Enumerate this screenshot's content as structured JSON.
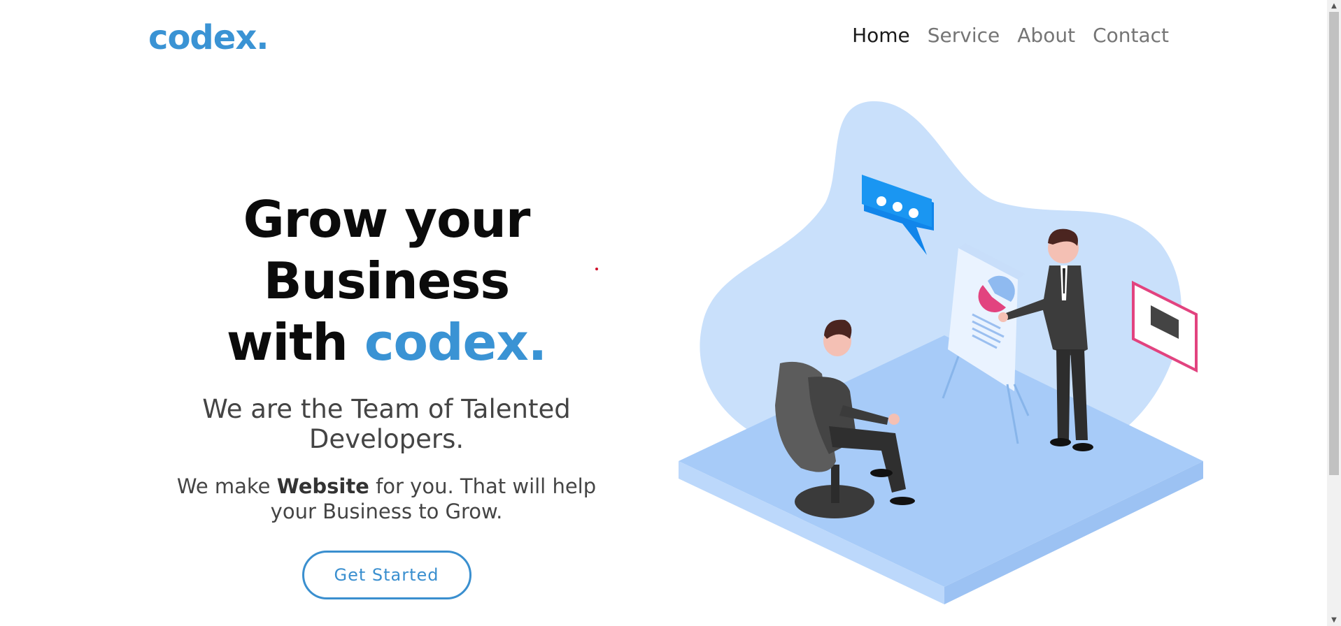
{
  "header": {
    "logo": "codex.",
    "nav": [
      {
        "label": "Home",
        "active": true
      },
      {
        "label": "Service",
        "active": false
      },
      {
        "label": "About",
        "active": false
      },
      {
        "label": "Contact",
        "active": false
      }
    ]
  },
  "hero": {
    "title_line1": "Grow your Business",
    "title_line2_prefix": "with ",
    "title_brand": "codex.",
    "tagline": "We are the Team of Talented Developers.",
    "desc_prefix": "We make ",
    "desc_bold": "Website",
    "desc_suffix": " for you. That will help your Business to Grow.",
    "cta_label": "Get Started"
  },
  "colors": {
    "brand": "#3a93d4",
    "nav_active": "#1a1a1a",
    "nav_inactive": "#757575"
  },
  "icons": {
    "scroll_up": "▲",
    "scroll_down": "▼"
  }
}
